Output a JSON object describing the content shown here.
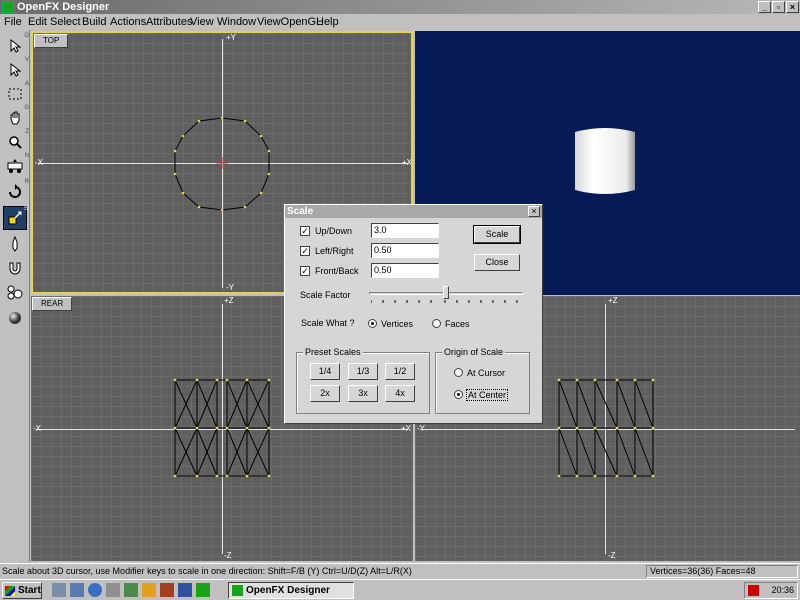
{
  "window": {
    "title": "OpenFX Designer"
  },
  "menu": [
    {
      "label": "File"
    },
    {
      "label": "Edit"
    },
    {
      "label": "Select"
    },
    {
      "label": "Build"
    },
    {
      "label": "Actions"
    },
    {
      "label": "Attributes"
    },
    {
      "label": "View"
    },
    {
      "label": "Window"
    },
    {
      "label": "ViewOpenGL"
    },
    {
      "label": "Help"
    }
  ],
  "tools": [
    {
      "icon": "select-arrow-icon",
      "key": "O"
    },
    {
      "icon": "vertex-select-icon",
      "key": "V"
    },
    {
      "icon": "box-select-icon",
      "key": "A"
    },
    {
      "icon": "pan-hand-icon",
      "key": "G"
    },
    {
      "icon": "zoom-icon",
      "key": "Z"
    },
    {
      "icon": "move-icon",
      "key": "N"
    },
    {
      "icon": "rotate-icon",
      "key": "R"
    },
    {
      "icon": "scale-icon",
      "key": "S"
    },
    {
      "icon": "pen-icon",
      "key": ""
    },
    {
      "icon": "magnet-icon",
      "key": ""
    },
    {
      "icon": "spheres-icon",
      "key": ""
    },
    {
      "icon": "sphere-icon",
      "key": ""
    }
  ],
  "viewports": {
    "top": {
      "label": "TOP",
      "ax_y_top": "+Y",
      "ax_y_bottom": "-Y",
      "ax_x_left": "-X",
      "ax_x_right": "+X"
    },
    "rear": {
      "label": "REAR",
      "ax_z_top": "+Z",
      "ax_z_bottom": "-Z",
      "ax_x_left": "-X",
      "ax_x_right": "+X"
    },
    "side": {
      "ax_z_top": "+Z",
      "ax_z_bottom": "-Z",
      "ax_y_left": "-Y"
    }
  },
  "dialog": {
    "title": "Scale",
    "up_down_label": "Up/Down",
    "up_down_value": "3.0",
    "left_right_label": "Left/Right",
    "left_right_value": "0.50",
    "front_back_label": "Front/Back",
    "front_back_value": "0.50",
    "scale_button": "Scale",
    "close_button": "Close",
    "scale_factor_label": "Scale Factor",
    "scale_what_label": "Scale What ?",
    "vertices_label": "Vertices",
    "faces_label": "Faces",
    "preset_title": "Preset Scales",
    "presets": [
      "1/4",
      "1/3",
      "1/2",
      "2x",
      "3x",
      "4x"
    ],
    "origin_title": "Origin of Scale",
    "at_cursor_label": "At Cursor",
    "at_center_label": "At Center"
  },
  "status": {
    "message": "Scale about 3D cursor, use Modifier keys to scale in one direction: Shift=F/B (Y)  Ctrl=U/D(Z)  Alt=L/R(X)",
    "counts": "Vertices=36(36) Faces=48"
  },
  "taskbar": {
    "start": "Start",
    "task": "OpenFX Designer",
    "clock": "20:36"
  }
}
